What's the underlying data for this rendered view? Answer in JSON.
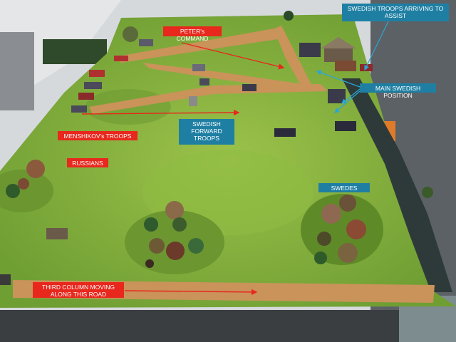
{
  "annotations": {
    "peter": "PETER's COMMAND",
    "menshikov": "MENSHIKOV's TROOPS",
    "russians": "RUSSIANS",
    "swedish_forward": "SWEDISH FORWARD TROOPS",
    "main_swedish": "MAIN SWEDISH POSITION",
    "swedes": "SWEDES",
    "arriving": "SWEDISH TROOPS ARRIVING TO ASSIST",
    "third_column": "THIRD COLUMN MOVING ALONG THIS ROAD"
  },
  "colors": {
    "red_label": "#e8271d",
    "blue_label": "#1f7fa3",
    "table_green": "#7aa83a",
    "road": "#c9935a",
    "river": "#2e3a3a"
  }
}
